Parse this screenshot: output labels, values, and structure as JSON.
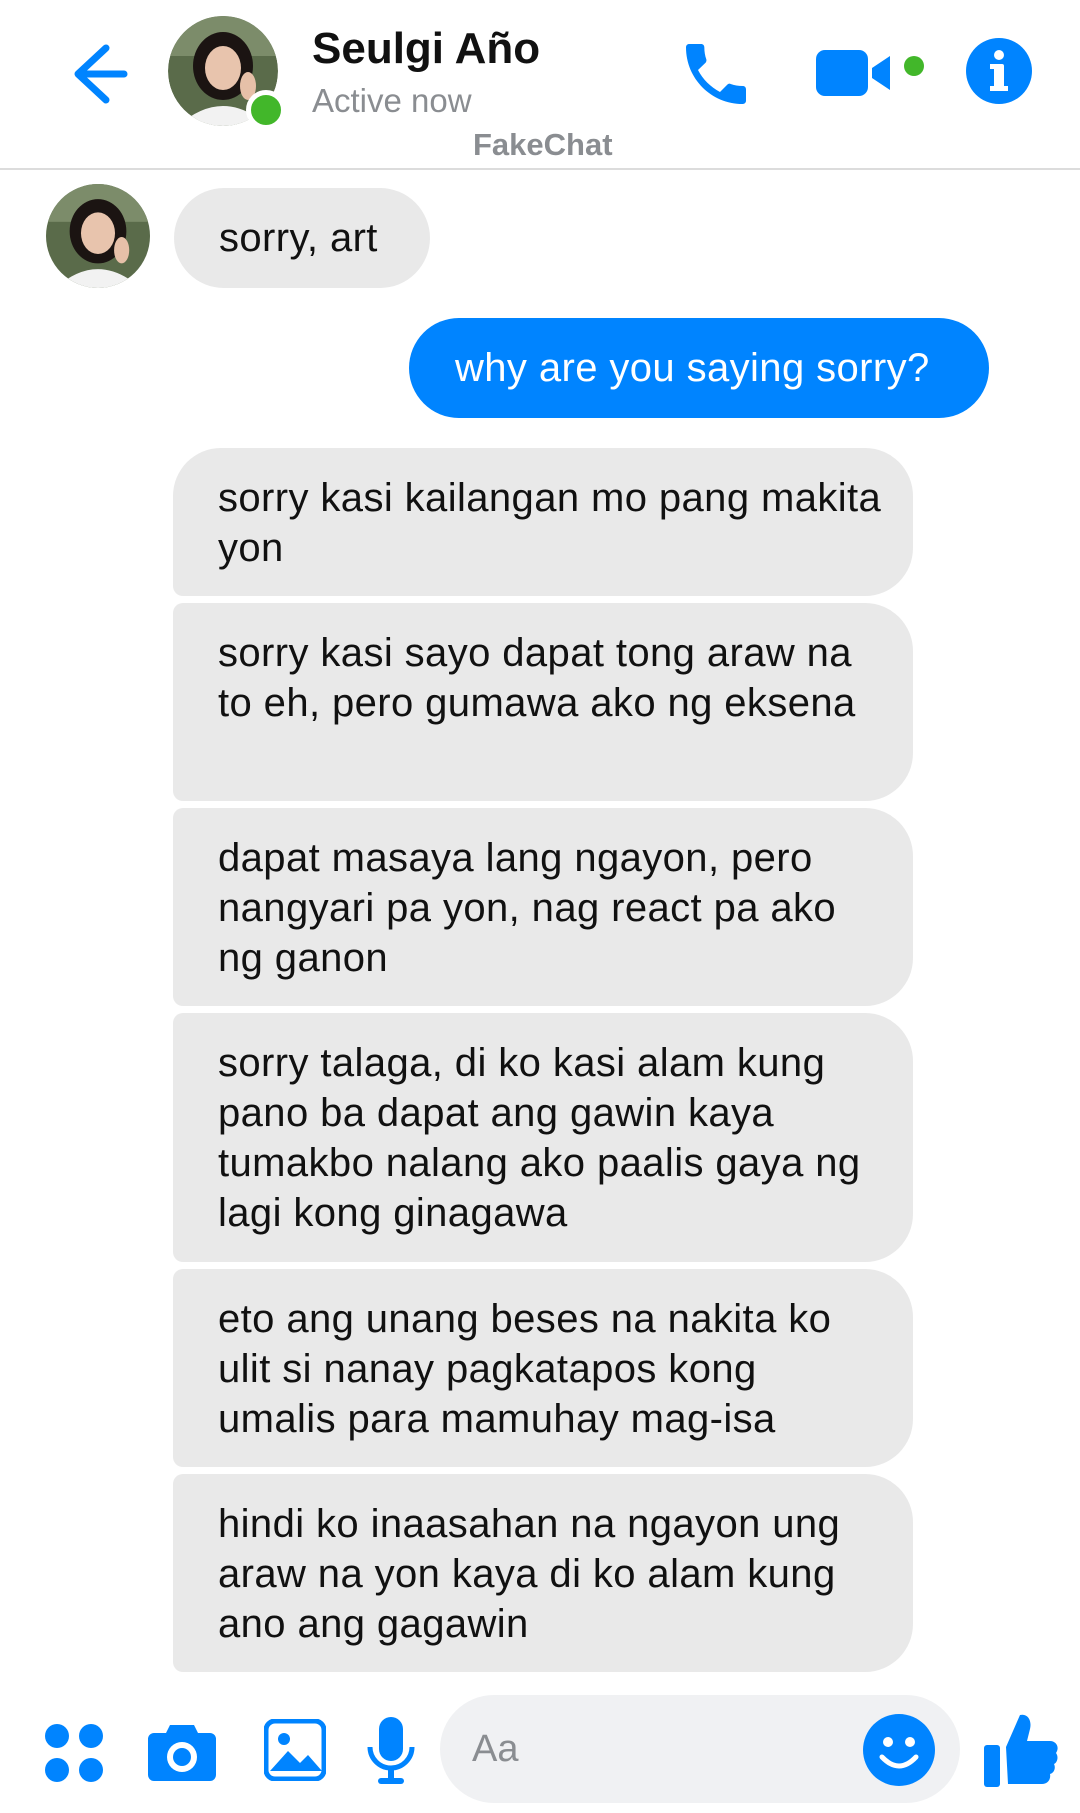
{
  "header": {
    "contact_name": "Seulgi Año",
    "status": "Active now",
    "watermark": "FakeChat"
  },
  "icons": {
    "back": "arrow-left-icon",
    "call": "phone-icon",
    "video": "video-camera-icon",
    "info": "info-icon",
    "apps": "four-dots-icon",
    "camera": "camera-icon",
    "gallery": "image-icon",
    "mic": "microphone-icon",
    "emoji": "smiley-icon",
    "like": "thumbs-up-icon"
  },
  "colors": {
    "accent": "#0084ff",
    "online": "#42b72a",
    "incoming_bubble": "#e9e9e9"
  },
  "messages": [
    {
      "from": "them",
      "text": "sorry, art"
    },
    {
      "from": "me",
      "text": "why are you saying sorry?"
    },
    {
      "from": "them",
      "text": "sorry kasi kailangan mo pang makita yon"
    },
    {
      "from": "them",
      "text": "sorry kasi sayo dapat tong araw na to eh, pero gumawa ako ng eksena"
    },
    {
      "from": "them",
      "text": "dapat masaya lang ngayon, pero nangyari pa yon, nag react pa ako ng ganon"
    },
    {
      "from": "them",
      "text": "sorry talaga, di ko kasi alam kung pano ba dapat ang gawin kaya tumakbo nalang ako paalis gaya ng lagi kong ginagawa"
    },
    {
      "from": "them",
      "text": "eto ang unang beses na nakita ko ulit si nanay pagkatapos kong umalis para mamuhay mag-isa"
    },
    {
      "from": "them",
      "text": "hindi ko inaasahan na ngayon ung araw na yon kaya di ko alam kung ano ang gagawin"
    }
  ],
  "composer": {
    "placeholder": "Aa"
  }
}
